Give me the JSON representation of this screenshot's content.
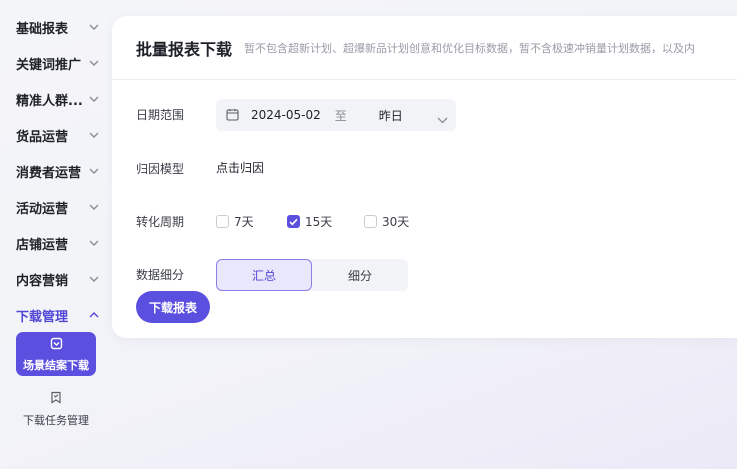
{
  "sidebar": {
    "items": [
      {
        "label": "基础报表",
        "expanded": false
      },
      {
        "label": "关键词推广",
        "expanded": false
      },
      {
        "label": "精准人群...",
        "expanded": false
      },
      {
        "label": "货品运营",
        "expanded": false
      },
      {
        "label": "消费者运营",
        "expanded": false
      },
      {
        "label": "活动运营",
        "expanded": false
      },
      {
        "label": "店铺运营",
        "expanded": false
      },
      {
        "label": "内容营销",
        "expanded": false
      },
      {
        "label": "下载管理",
        "expanded": true
      }
    ],
    "sub_items": [
      {
        "label": "场景结案下载",
        "icon": "download-doc-icon",
        "active": true
      },
      {
        "label": "下载任务管理",
        "icon": "task-bookmark-icon",
        "active": false
      }
    ]
  },
  "card": {
    "title": "批量报表下载",
    "note": "暂不包含超新计划、超爆新品计划创意和优化目标数据，暂不含极速冲销量计划数据，以及内"
  },
  "form": {
    "date_range": {
      "label": "日期范围",
      "start": "2024-05-02",
      "separator": "至",
      "end": "昨日"
    },
    "attribution": {
      "label": "归因模型",
      "value": "点击归因"
    },
    "conversion": {
      "label": "转化周期",
      "options": [
        {
          "label": "7天",
          "checked": false
        },
        {
          "label": "15天",
          "checked": true
        },
        {
          "label": "30天",
          "checked": false
        }
      ]
    },
    "breakdown": {
      "label": "数据细分",
      "options": [
        {
          "label": "汇总",
          "selected": true
        },
        {
          "label": "细分",
          "selected": false
        }
      ]
    },
    "submit_label": "下载报表"
  },
  "colors": {
    "accent": "#5b4fe0",
    "accent_text": "#5146d6",
    "field_bg": "#f2f3f6"
  }
}
